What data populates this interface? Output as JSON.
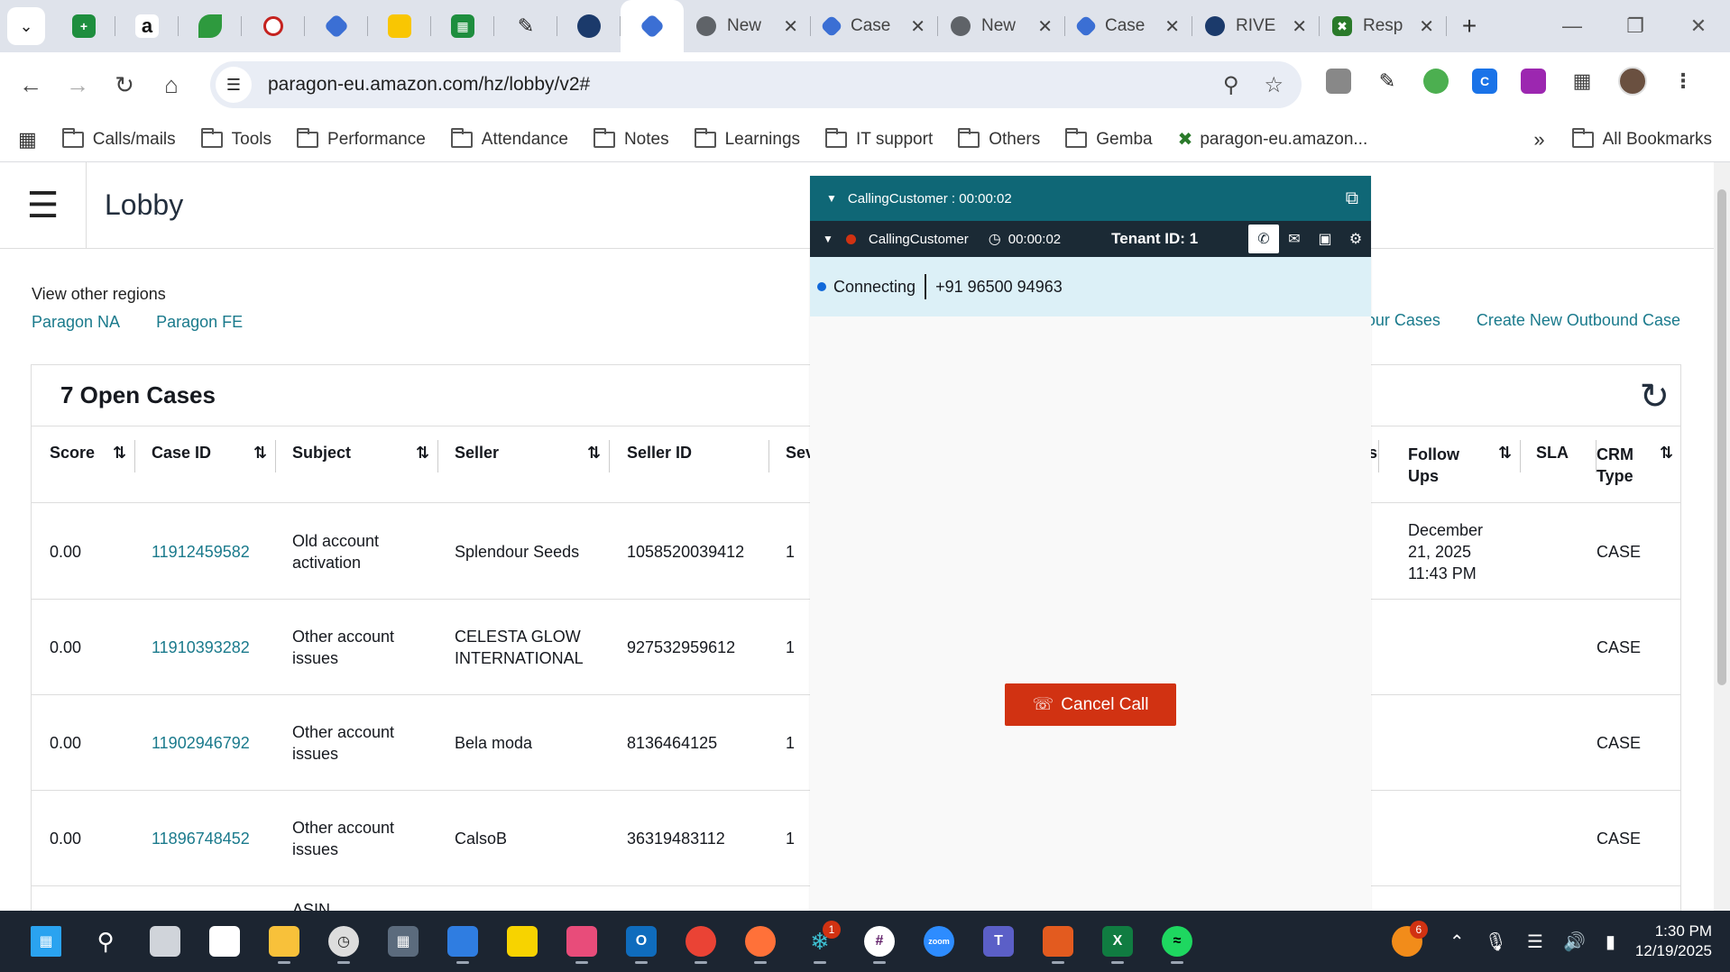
{
  "browser": {
    "tabs": [
      {
        "title": "New",
        "icon": "chrome-icon",
        "color": "#5f6368"
      },
      {
        "title": "Case",
        "icon": "paragon-icon",
        "color": "#3b6fd4"
      },
      {
        "title": "New",
        "icon": "chrome-icon",
        "color": "#5f6368"
      },
      {
        "title": "Case",
        "icon": "paragon-icon",
        "color": "#3b6fd4"
      },
      {
        "title": "RIVE",
        "icon": "river-icon",
        "color": "#1b3a6b"
      },
      {
        "title": "Resp",
        "icon": "response-icon",
        "color": "#2a7a2a"
      }
    ],
    "url": "paragon-eu.amazon.com/hz/lobby/v2#"
  },
  "bookmarks": {
    "items": [
      "Calls/mails",
      "Tools",
      "Performance",
      "Attendance",
      "Notes",
      "Learnings",
      "IT support",
      "Others",
      "Gemba"
    ],
    "site_bookmark": "paragon-eu.amazon...",
    "all_bookmarks": "All Bookmarks"
  },
  "page": {
    "title": "Lobby",
    "regions_label": "View other regions",
    "region_links": [
      "Paragon NA",
      "Paragon FE"
    ],
    "your_cases": "Your Cases",
    "create_case": "Create New Outbound Case",
    "open_cases_title": "7 Open Cases",
    "columns": [
      "Score",
      "Case ID",
      "Subject",
      "Seller",
      "Seller ID",
      "Sev",
      "s",
      "Follow Ups",
      "SLA",
      "CRM Type"
    ],
    "rows": [
      {
        "score": "0.00",
        "case_id": "11912459582",
        "subject": "Old account activation",
        "seller": "Splendour Seeds",
        "seller_id": "1058520039412",
        "sev": "1",
        "follow_ups": "December 21, 2025 11:43 PM",
        "crm": "CASE"
      },
      {
        "score": "0.00",
        "case_id": "11910393282",
        "subject": "Other account issues",
        "seller": "CELESTA GLOW INTERNATIONAL",
        "seller_id": "927532959612",
        "sev": "1",
        "follow_ups": "",
        "crm": "CASE"
      },
      {
        "score": "0.00",
        "case_id": "11902946792",
        "subject": "Other account issues",
        "seller": "Bela moda",
        "seller_id": "8136464125",
        "sev": "1",
        "follow_ups": "",
        "crm": "CASE"
      },
      {
        "score": "0.00",
        "case_id": "11896748452",
        "subject": "Other account issues",
        "seller": "CalsoB",
        "seller_id": "36319483112",
        "sev": "1",
        "follow_ups": "",
        "crm": "CASE"
      }
    ],
    "partial_row_subject": "ASIN"
  },
  "softphone": {
    "header": "CallingCustomer : 00:00:02",
    "state": "CallingCustomer",
    "timer": "00:00:02",
    "tenant": "Tenant ID: 1",
    "status": "Connecting",
    "number": "+91 96500 94963",
    "cancel_label": "Cancel Call"
  },
  "taskbar": {
    "time": "1:30 PM",
    "date": "12/19/2025",
    "slack_badge": "1",
    "tray_badge": "6"
  }
}
